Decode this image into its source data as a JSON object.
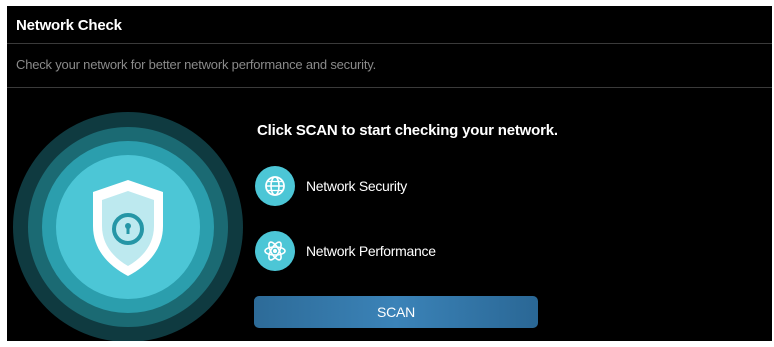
{
  "header": {
    "title": "Network Check",
    "subtitle": "Check your network for better network performance and security."
  },
  "main": {
    "heading": "Click SCAN to start checking your network.",
    "features": [
      {
        "label": "Network Security",
        "icon": "globe-icon"
      },
      {
        "label": "Network Performance",
        "icon": "atom-icon"
      }
    ],
    "scan_label": "SCAN",
    "illustration_icon": "shield-lock-icon"
  },
  "colors": {
    "background": "#000000",
    "accent": "#4cc6d6",
    "button": "#3b83b8",
    "subtitle": "#8a8a8a"
  }
}
